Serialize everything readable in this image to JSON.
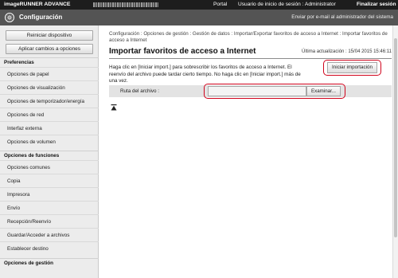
{
  "topbar": {
    "brand": "imageRUNNER ADVANCE",
    "portal": "Portal",
    "user": "Usuario de inicio de sesión : Administrator",
    "logout": "Finalizar sesión"
  },
  "header": {
    "title": "Configuración",
    "mail_link": "Enviar por e-mail al administrador del sistema"
  },
  "sidebar": {
    "restart_button": "Reiniciar dispositivo",
    "apply_button": "Aplicar cambios a opciones",
    "sections": [
      {
        "label": "Preferencias"
      },
      {
        "label": "Opciones de funciones"
      },
      {
        "label": "Opciones de gestión"
      }
    ],
    "preferences_items": [
      {
        "label": "Opciones de papel"
      },
      {
        "label": "Opciones de visualización"
      },
      {
        "label": "Opciones de temporizador/energía"
      },
      {
        "label": "Opciones de red"
      },
      {
        "label": "Interfaz externa"
      },
      {
        "label": "Opciones de volumen"
      }
    ],
    "function_items": [
      {
        "label": "Opciones comunes"
      },
      {
        "label": "Copia"
      },
      {
        "label": "Impresora"
      },
      {
        "label": "Envío"
      },
      {
        "label": "Recepción/Reenvío"
      },
      {
        "label": "Guardar/Acceder a archivos"
      },
      {
        "label": "Establecer destino"
      }
    ]
  },
  "main": {
    "breadcrumb": "Configuración : Opciones de gestión : Gestión de datos : Importar/Exportar favoritos de acceso a Internet : Importar favoritos de acceso a Internet",
    "title": "Importar favoritos de acceso a Internet",
    "last_updated": "Última actualización : 15/04 2015 15:46:11",
    "description": "Haga clic en [Iniciar import.] para sobrescribir los favoritos de acceso a Internet. El reenvío del archivo puede tardar cierto tiempo. No haga clic en [Iniciar import.] más de una vez.",
    "start_button": "Iniciar importación",
    "file_label": "Ruta del archivo :",
    "file_value": "",
    "browse_button": "Examinar..."
  },
  "colors": {
    "topbar": "#1d1d1d",
    "header": "#545454",
    "highlight": "#d0021b"
  }
}
